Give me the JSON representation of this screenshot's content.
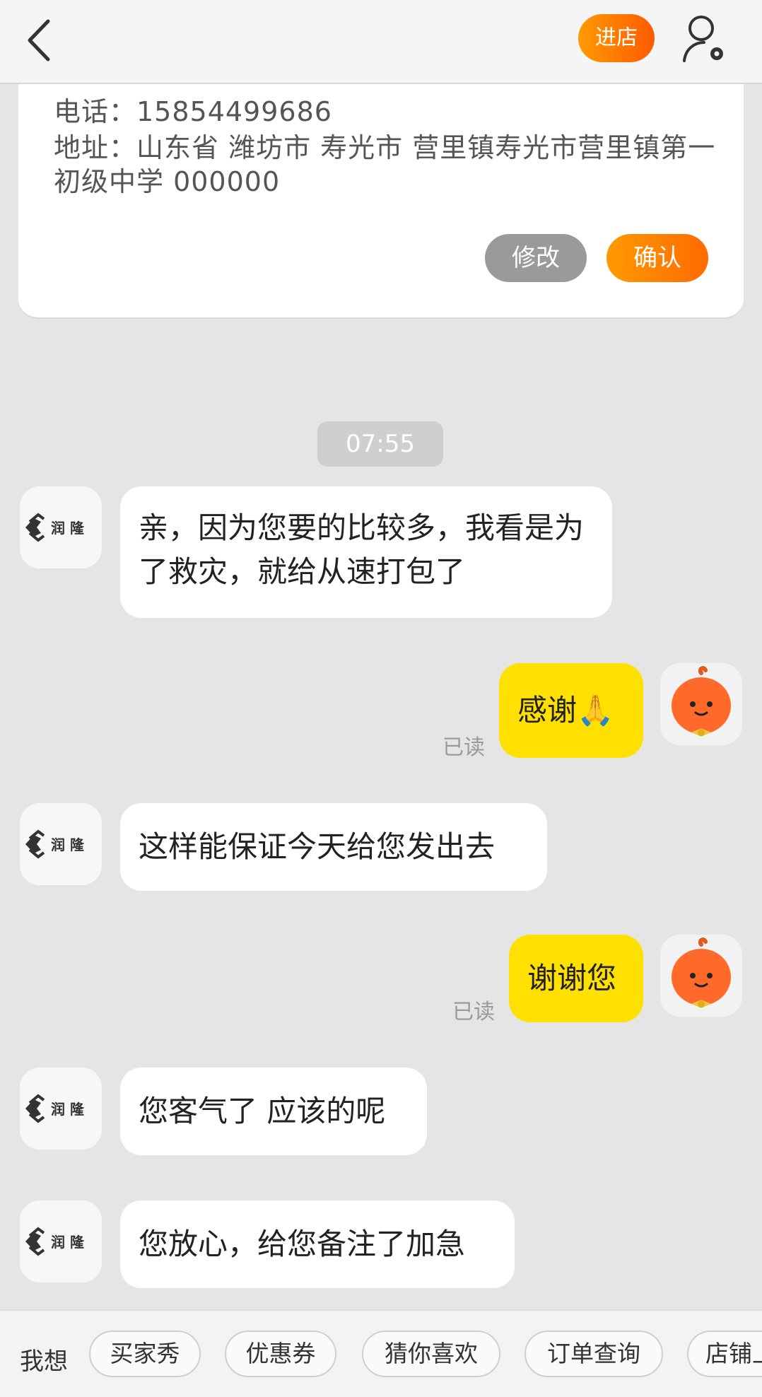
{
  "header": {
    "shop_button_label": "进店",
    "icons": {
      "back": "chevron-left-icon",
      "user": "user-settings-icon"
    }
  },
  "address_card": {
    "phone_line": "电话：15854499686",
    "address_line": "地址：山东省 潍坊市 寿光市 营里镇寿光市营里镇第一初级中学 000000",
    "modify_label": "修改",
    "confirm_label": "确认"
  },
  "timestamp": "07:55",
  "shop_avatar_text": "润 隆",
  "messages": [
    {
      "from": "shop",
      "text": "亲，因为您要的比较多，我看是为了救灾，就给从速打包了"
    },
    {
      "from": "me",
      "text": "感谢🙏",
      "status": "已读"
    },
    {
      "from": "shop",
      "text": "这样能保证今天给您发出去"
    },
    {
      "from": "me",
      "text": "谢谢您",
      "status": "已读"
    },
    {
      "from": "shop",
      "text": "您客气了 应该的呢"
    },
    {
      "from": "shop",
      "text": "您放心，给您备注了加急"
    }
  ],
  "quick_bar": {
    "label": "我想",
    "chips": [
      "买家秀",
      "优惠券",
      "猜你喜欢",
      "订单查询",
      "店铺上新"
    ]
  },
  "colors": {
    "accent_orange": "#ff7a00",
    "my_bubble": "#ffe000",
    "background": "#e5e5e5"
  }
}
